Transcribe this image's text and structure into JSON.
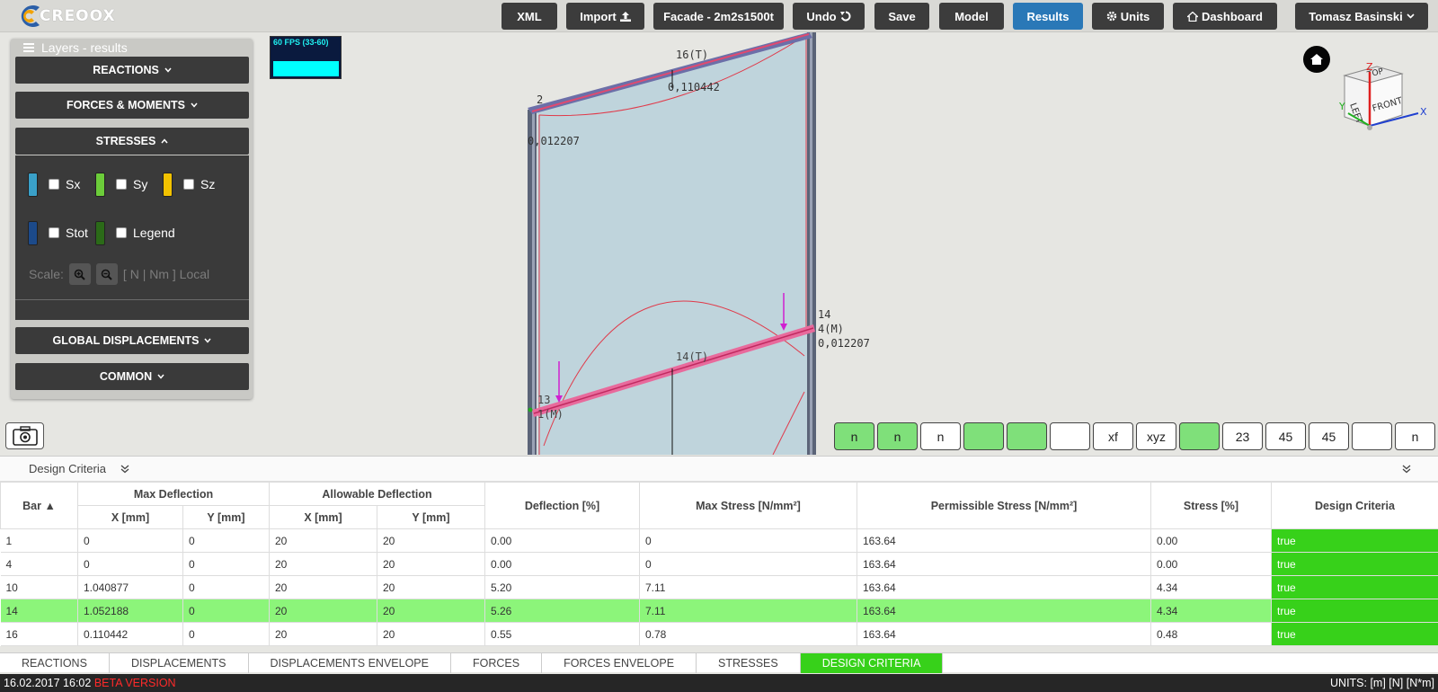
{
  "app": {
    "brand": "CREOOX"
  },
  "toolbar": {
    "xml": "XML",
    "import": "Import",
    "project": "Facade - 2m2s1500t",
    "undo": "Undo",
    "save": "Save",
    "model": "Model",
    "results": "Results",
    "units": "Units",
    "dashboard": "Dashboard",
    "user": "Tomasz Basinski"
  },
  "layers": {
    "title": "Layers - results",
    "sections": {
      "reactions": "REACTIONS",
      "forces": "FORCES & MOMENTS",
      "stresses": "STRESSES",
      "global_disp": "GLOBAL DISPLACEMENTS",
      "common": "COMMON"
    },
    "stress_items": [
      {
        "label": "Sx",
        "color": "#3aa0c8",
        "checked": false
      },
      {
        "label": "Sy",
        "color": "#6ccc3a",
        "checked": false
      },
      {
        "label": "Sz",
        "color": "#f2c200",
        "checked": false
      },
      {
        "label": "Stot",
        "color": "#1c4a8a",
        "checked": false
      },
      {
        "label": "Legend",
        "color": "#2b6a18",
        "checked": false
      }
    ],
    "scale_label": "Scale:",
    "units_hint": "[ N | Nm ] Local"
  },
  "viewport": {
    "fps": "60 FPS (33-60)",
    "labels": {
      "bar16": "16(T)",
      "val_top": "0,110442",
      "node2": "2",
      "val_left": "0,012207",
      "node14": "14",
      "member4": "4(M)",
      "val_right": "0,012207",
      "bar14": "14(T)",
      "node13": "13",
      "member1": "1(M)"
    },
    "cube": {
      "top": "TOP",
      "left": "LEFT",
      "front": "FRONT",
      "x": "X",
      "y": "Y",
      "z": "Z"
    }
  },
  "tools": [
    {
      "icon": "node-numbers-icon",
      "label": "n",
      "on": true
    },
    {
      "icon": "bar-numbers-icon",
      "label": "n",
      "on": true
    },
    {
      "icon": "plate-numbers-icon",
      "label": "n",
      "on": false
    },
    {
      "icon": "plates-icon",
      "label": "",
      "on": true
    },
    {
      "icon": "profiles-icon",
      "label": "",
      "on": true
    },
    {
      "icon": "supports-icon",
      "label": "",
      "on": false
    },
    {
      "icon": "releases-icon",
      "label": "xf",
      "on": false
    },
    {
      "icon": "local-axes-icon",
      "label": "xyz",
      "on": false
    },
    {
      "icon": "loads-icon",
      "label": "",
      "on": true
    },
    {
      "icon": "load-values-icon",
      "label": "23",
      "on": false
    },
    {
      "icon": "angle-icon",
      "label": "45",
      "on": false
    },
    {
      "icon": "angle-support-icon",
      "label": "45",
      "on": false
    },
    {
      "icon": "grid-icon",
      "label": "",
      "on": false
    },
    {
      "icon": "support-numbers-icon",
      "label": "n",
      "on": false
    }
  ],
  "results": {
    "title": "Design Criteria",
    "headers": {
      "bar": "Bar ▲",
      "max_def": "Max Deflection",
      "allow_def": "Allowable Deflection",
      "x": "X [mm]",
      "y": "Y [mm]",
      "def_pct": "Deflection [%]",
      "max_stress": "Max Stress [N/mm²]",
      "perm_stress": "Permissible Stress [N/mm²]",
      "stress_pct": "Stress [%]",
      "criteria": "Design Criteria"
    },
    "rows": [
      [
        "1",
        "0",
        "0",
        "20",
        "20",
        "0.00",
        "0",
        "163.64",
        "0.00",
        "true"
      ],
      [
        "4",
        "0",
        "0",
        "20",
        "20",
        "0.00",
        "0",
        "163.64",
        "0.00",
        "true"
      ],
      [
        "10",
        "1.040877",
        "0",
        "20",
        "20",
        "5.20",
        "7.11",
        "163.64",
        "4.34",
        "true"
      ],
      [
        "14",
        "1.052188",
        "0",
        "20",
        "20",
        "5.26",
        "7.11",
        "163.64",
        "4.34",
        "true"
      ],
      [
        "16",
        "0.110442",
        "0",
        "20",
        "20",
        "0.55",
        "0.78",
        "163.64",
        "0.48",
        "true"
      ]
    ],
    "highlighted_row": 3
  },
  "tabs": [
    "REACTIONS",
    "DISPLACEMENTS",
    "DISPLACEMENTS ENVELOPE",
    "FORCES",
    "FORCES ENVELOPE",
    "STRESSES",
    "DESIGN CRITERIA"
  ],
  "active_tab": 6,
  "status": {
    "datetime": "16.02.2017 16:02",
    "beta": "BETA VERSION",
    "units": "UNITS: [m] [N] [N*m]"
  }
}
